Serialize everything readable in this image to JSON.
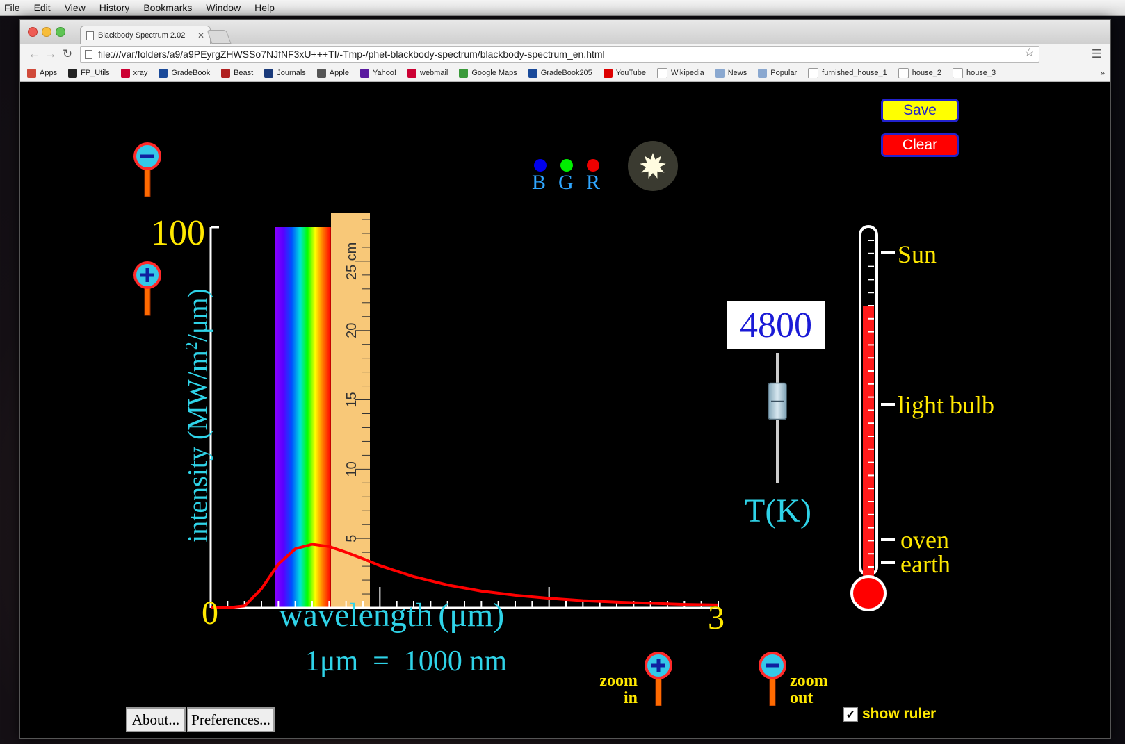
{
  "menubar": {
    "items": [
      "File",
      "Edit",
      "View",
      "History",
      "Bookmarks",
      "Window",
      "Help"
    ]
  },
  "browser": {
    "tab_title": "Blackbody Spectrum 2.02",
    "url": "file:///var/folders/a9/a9PEyrgZHWSSo7NJfNF3xU+++TI/-Tmp-/phet-blackbody-spectrum/blackbody-spectrum_en.html",
    "bookmarks": [
      {
        "label": "Apps",
        "icon": "apps-grid-icon",
        "color": "#d04a3a"
      },
      {
        "label": "FP_Utils",
        "icon": "github-icon",
        "color": "#222222"
      },
      {
        "label": "xray",
        "icon": "rutgers-r-icon",
        "color": "#cc0033"
      },
      {
        "label": "GradeBook",
        "icon": "gradebook-icon",
        "color": "#1a4a9a"
      },
      {
        "label": "Beast",
        "icon": "beast-icon",
        "color": "#b02020"
      },
      {
        "label": "Journals",
        "icon": "ads-icon",
        "color": "#1a3a7a"
      },
      {
        "label": "Apple",
        "icon": "apple-icon",
        "color": "#555555"
      },
      {
        "label": "Yahoo!",
        "icon": "yahoo-icon",
        "color": "#5a1aa0"
      },
      {
        "label": "webmail",
        "icon": "webmail-icon",
        "color": "#cc0033"
      },
      {
        "label": "Google Maps",
        "icon": "maps-icon",
        "color": "#3a9a3a"
      },
      {
        "label": "GradeBook205",
        "icon": "gradebook-icon",
        "color": "#1a4a9a"
      },
      {
        "label": "YouTube",
        "icon": "youtube-icon",
        "color": "#dd0000"
      },
      {
        "label": "Wikipedia",
        "icon": "wikipedia-icon",
        "color": "#ffffff"
      },
      {
        "label": "News",
        "icon": "folder-icon",
        "color": "#8aa8d0"
      },
      {
        "label": "Popular",
        "icon": "folder-icon",
        "color": "#8aa8d0"
      },
      {
        "label": "furnished_house_1",
        "icon": "page-icon",
        "color": "#ffffff"
      },
      {
        "label": "house_2",
        "icon": "page-icon",
        "color": "#ffffff"
      },
      {
        "label": "house_3",
        "icon": "page-icon",
        "color": "#ffffff"
      }
    ],
    "bookmarks_overflow": "»"
  },
  "sim": {
    "buttons": {
      "save": "Save",
      "clear": "Clear",
      "about": "About...",
      "preferences": "Preferences..."
    },
    "temperature": {
      "value": "4800",
      "label": "T(K)",
      "value_K": 4800,
      "min_K": 300,
      "max_K": 6000,
      "slider_fraction": 0.63
    },
    "thermometer": {
      "labels": [
        "Sun",
        "light bulb",
        "oven",
        "earth"
      ],
      "fill_fraction": 0.79
    },
    "rgb_labels": [
      "B",
      "G",
      "R"
    ],
    "rgb_colors": [
      "#0000ee",
      "#00ee00",
      "#ee0000"
    ],
    "graph": {
      "y_max_label": "100",
      "y_axis_label": "intensity (MW/m",
      "y_axis_sup": "2",
      "y_axis_tail": "/μm)",
      "x_min_label": "0",
      "x_max_label": "3",
      "x_axis_label": "wavelength",
      "x_axis_unit": "(μm)",
      "conversion": "1μm  =  1000 nm",
      "curve_color": "#ff0000"
    },
    "ruler": {
      "unit": "cm",
      "labels": [
        "5",
        "10",
        "15",
        "20",
        "25 cm"
      ]
    },
    "zoom": {
      "in_label_1": "zoom",
      "in_label_2": "in",
      "out_label_1": "zoom",
      "out_label_2": "out"
    },
    "show_ruler": {
      "label": "show ruler",
      "checked": true
    }
  },
  "chart_data": {
    "type": "line",
    "title": "",
    "xlabel": "wavelength (μm)",
    "ylabel": "intensity (MW/m²/μm)",
    "xlim": [
      0,
      3
    ],
    "ylim": [
      0,
      100
    ],
    "series": [
      {
        "x": [
          0.1,
          0.2,
          0.3,
          0.4,
          0.5,
          0.6,
          0.7,
          0.8,
          0.9,
          1.0,
          1.2,
          1.4,
          1.6,
          1.8,
          2.0,
          2.2,
          2.4,
          2.6,
          2.8,
          3.0
        ],
        "y": [
          0.0,
          0.5,
          5.0,
          11.5,
          15.5,
          16.7,
          16.1,
          14.6,
          12.9,
          11.1,
          8.2,
          6.0,
          4.4,
          3.3,
          2.5,
          1.9,
          1.5,
          1.2,
          0.9,
          0.75
        ]
      }
    ]
  }
}
